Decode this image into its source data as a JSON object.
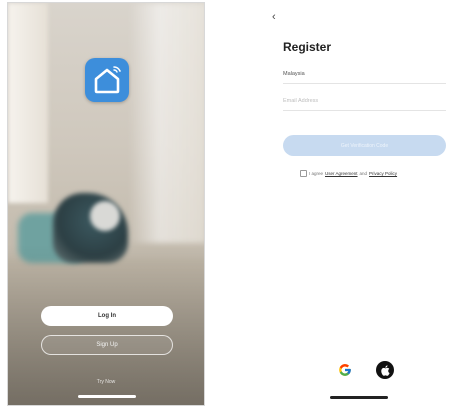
{
  "login_screen": {
    "app_icon": "smart-home-icon",
    "login_button_label": "Log In",
    "signup_button_label": "Sign Up",
    "try_now_label": "Try Now"
  },
  "register_screen": {
    "back_icon": "chevron-left-icon",
    "back_glyph": "‹",
    "title": "Register",
    "country_value": "Malaysia",
    "email_placeholder": "Email Address",
    "get_code_label": "Get Verification Code",
    "agree_prefix": "I agree",
    "user_agreement_link": "User Agreement",
    "agree_and": "and",
    "privacy_policy_link": "Privacy Policy",
    "social": [
      "google-icon",
      "apple-icon"
    ]
  },
  "colors": {
    "brand_blue": "#3d8edb",
    "disabled_button": "#c7daf0"
  }
}
